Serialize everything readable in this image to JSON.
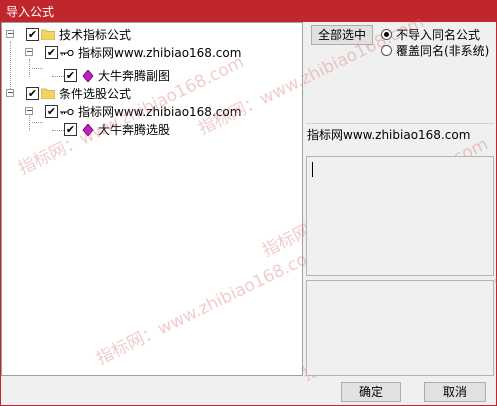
{
  "window": {
    "title": "导入公式"
  },
  "tree": {
    "groups": [
      {
        "label": "技术指标公式",
        "checked": true,
        "expander": "−",
        "children": [
          {
            "label": "指标网www.zhibiao168.com",
            "checked": true,
            "expander": "−",
            "children": [
              {
                "label": "大牛奔腾副图",
                "checked": true
              }
            ]
          }
        ]
      },
      {
        "label": "条件选股公式",
        "checked": true,
        "expander": "−",
        "children": [
          {
            "label": "指标网www.zhibiao168.com",
            "checked": true,
            "expander": "−",
            "children": [
              {
                "label": "大牛奔腾选股",
                "checked": true
              }
            ]
          }
        ]
      }
    ],
    "check_mark": "✔"
  },
  "options": {
    "select_all_label": "全部选中",
    "radio_skip_label": "不导入同名公式",
    "radio_overwrite_label": "覆盖同名(非系统)",
    "selected": "skip"
  },
  "info_text": "指标网www.zhibiao168.com",
  "footer": {
    "ok_label": "确定",
    "cancel_label": "取消"
  },
  "watermark_text": "指标网：www.zhibiao168.com",
  "colors": {
    "title_bar": "#c0272d",
    "folder": "#f3d463",
    "gem": "#c020c0"
  }
}
